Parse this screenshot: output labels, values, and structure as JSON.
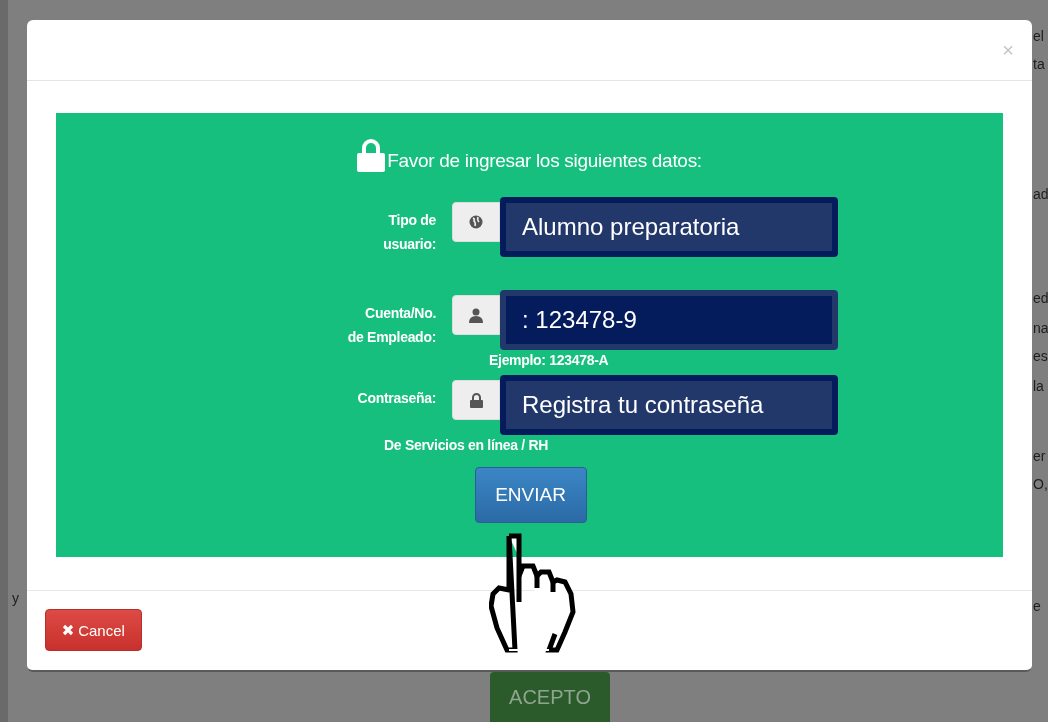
{
  "background_page": {
    "left_fragments": [
      "y"
    ],
    "right_fragments": [
      "el",
      "ta",
      "ad",
      "ed",
      "na",
      "es",
      "la",
      "er",
      "O,",
      "e"
    ],
    "accept_button": "ACEPTO"
  },
  "dialog": {
    "close": "×",
    "heading": "Favor de ingresar los siguientes datos:",
    "fields": [
      {
        "kind": "user_type",
        "label": "Tipo de usuario:",
        "callout": {
          "text": "Alumno preparatoria",
          "inverted": false
        }
      },
      {
        "kind": "account",
        "label": "Cuenta/No. de Empleado:",
        "callout": {
          "text": ": 123478-9",
          "inverted": true
        },
        "hint": "Ejemplo: 123478-A"
      },
      {
        "kind": "password",
        "label": "Contraseña:",
        "callout": {
          "text": "Registra tu contraseña",
          "inverted": false
        },
        "hint": "De Servicios en línea / RH"
      }
    ],
    "submit_button": "ENVIAR",
    "cancel_button": "Cancel"
  }
}
